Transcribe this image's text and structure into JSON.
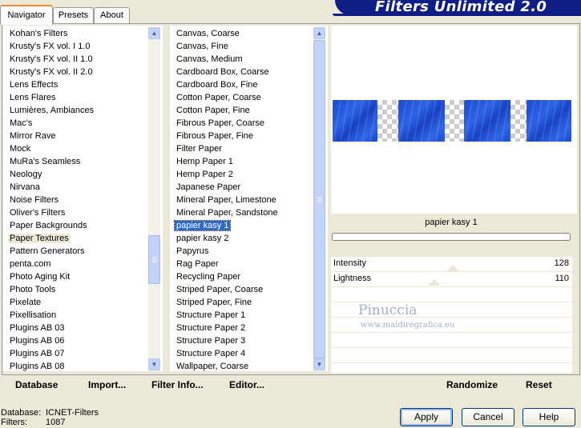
{
  "banner": {
    "title": "Filters Unlimited 2.0"
  },
  "tabs": [
    {
      "label": "Navigator",
      "active": true
    },
    {
      "label": "Presets",
      "active": false
    },
    {
      "label": "About",
      "active": false
    }
  ],
  "categories": {
    "items": [
      "Kohan's Filters",
      "Krusty's FX vol. I 1.0",
      "Krusty's FX vol. II 1.0",
      "Krusty's FX vol. II 2.0",
      "Lens Effects",
      "Lens Flares",
      "Lumières, Ambiances",
      "Mac's",
      "Mirror Rave",
      "Mock",
      "MuRa's Seamless",
      "Neology",
      "Nirvana",
      "Noise Filters",
      "Oliver's Filters",
      "Paper Backgrounds",
      "Paper Textures",
      "Pattern Generators",
      "penta.com",
      "Photo Aging Kit",
      "Photo Tools",
      "Pixelate",
      "Pixellisation",
      "Plugins AB 03",
      "Plugins AB 06",
      "Plugins AB 07",
      "Plugins AB 08"
    ],
    "selected": "Paper Textures"
  },
  "filters": {
    "items": [
      "Canvas, Coarse",
      "Canvas, Fine",
      "Canvas, Medium",
      "Cardboard Box, Coarse",
      "Cardboard Box, Fine",
      "Cotton Paper, Coarse",
      "Cotton Paper, Fine",
      "Fibrous Paper, Coarse",
      "Fibrous Paper, Fine",
      "Filter Paper",
      "Hemp Paper 1",
      "Hemp Paper 2",
      "Japanese Paper",
      "Mineral Paper, Limestone",
      "Mineral Paper, Sandstone",
      "papier kasy 1",
      "papier kasy 2",
      "Papyrus",
      "Rag Paper",
      "Recycling Paper",
      "Striped Paper, Coarse",
      "Striped Paper, Fine",
      "Structure Paper 1",
      "Structure Paper 2",
      "Structure Paper 3",
      "Structure Paper 4",
      "Wallpaper, Coarse"
    ],
    "selected": "papier kasy 1"
  },
  "preview": {
    "filter_name": "papier kasy 1"
  },
  "parameters": [
    {
      "label": "Intensity",
      "value": "128"
    },
    {
      "label": "Lightness",
      "value": "110"
    }
  ],
  "watermark": {
    "line1": "Pinuccia",
    "line2": "www.maidiregrafica.eu"
  },
  "bottom_buttons": {
    "database": "Database",
    "import": "Import...",
    "filter_info": "Filter Info...",
    "editor": "Editor...",
    "randomize": "Randomize",
    "reset": "Reset"
  },
  "dialog_buttons": {
    "apply": "Apply",
    "cancel": "Cancel",
    "help": "Help"
  },
  "status": {
    "database_label": "Database:",
    "database_value": "ICNET-Filters",
    "filters_label": "Filters:",
    "filters_value": "1087"
  },
  "colors": {
    "selection": "#316ac5",
    "banner": "#0f1e86",
    "tab_accent": "#e68b2c"
  }
}
